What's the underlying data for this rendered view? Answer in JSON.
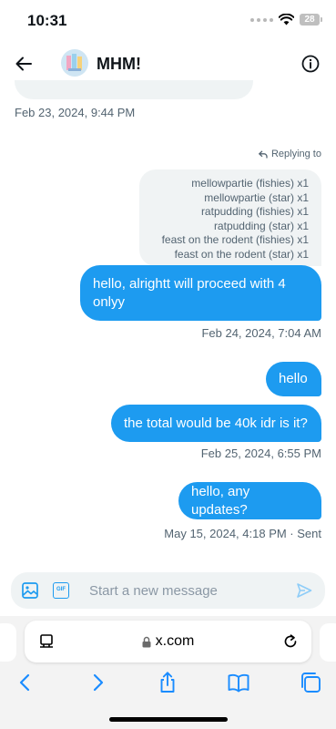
{
  "status": {
    "time": "10:31",
    "battery": "28"
  },
  "header": {
    "title": "MHM!"
  },
  "messages": {
    "prev_timestamp": "Feb 23, 2024, 9:44 PM",
    "replying_to": "Replying to",
    "quoted_lines": [
      "mellowpartie (fishies) x1",
      "mellowpartie (star) x1",
      "ratpudding (fishies) x1",
      "ratpudding (star) x1",
      "feast on the rodent (fishies) x1",
      "feast on the rodent (star) x1"
    ],
    "m1_text": "hello, alrightt will proceed with 4 onlyy",
    "m1_time": "Feb 24, 2024, 7:04 AM",
    "m2_text": "hello",
    "m3_text": "the total would be 40k idr is it?",
    "m3_time": "Feb 25, 2024, 6:55 PM",
    "m4_text": "hello, any updates?",
    "m4_time": "May 15, 2024, 4:18 PM · Sent"
  },
  "composer": {
    "placeholder": "Start a new message",
    "gif_label": "GIF"
  },
  "browser": {
    "url": "x.com"
  },
  "colors": {
    "accent": "#1d9bf0",
    "bubble_text": "#ffffff",
    "muted": "#536471"
  },
  "icons": [
    "back-arrow-icon",
    "info-icon",
    "image-icon",
    "gif-icon",
    "send-icon",
    "reader-icon",
    "lock-icon",
    "reload-icon",
    "back-icon",
    "forward-icon",
    "share-icon",
    "bookmarks-icon",
    "tabs-icon"
  ]
}
